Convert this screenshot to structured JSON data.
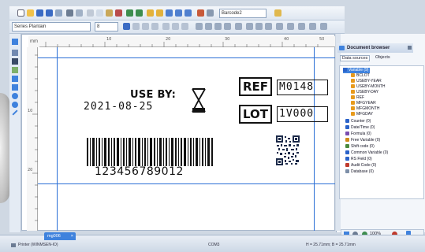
{
  "toolbar": {
    "barcode_combo": "Barcode2",
    "font_combo": "Series Plantain",
    "size_combo": "8"
  },
  "ruler": {
    "units": "mm",
    "marks": [
      "10",
      "20",
      "30",
      "40",
      "50"
    ],
    "left_marks": [
      "10",
      "20"
    ]
  },
  "label": {
    "use_by_text": "USE BY:",
    "date_value": "2021-08-25",
    "ref_label": "REF",
    "ref_value": "M0148",
    "lot_label": "LOT",
    "lot_value": "1V000",
    "barcode_number": "123456789012"
  },
  "panel": {
    "title": "Document browser",
    "tabs": [
      "Data sources",
      "Objects"
    ],
    "tree": [
      {
        "label": "Variable (9)",
        "color": "#2a62c9"
      },
      {
        "label": "BCLOT",
        "color": "#e89a1c"
      },
      {
        "label": "USEBY-YEAR",
        "color": "#e89a1c"
      },
      {
        "label": "USEBY-MONTH",
        "color": "#e89a1c"
      },
      {
        "label": "USEBY-DAY",
        "color": "#e89a1c"
      },
      {
        "label": "REF",
        "color": "#e89a1c"
      },
      {
        "label": "MFGYEAR",
        "color": "#e89a1c"
      },
      {
        "label": "MFGMONTH",
        "color": "#e89a1c"
      },
      {
        "label": "MFGDAY",
        "color": "#e89a1c"
      },
      {
        "label": "Counter (0)",
        "color": "#2a62c9"
      },
      {
        "label": "Date/Time (0)",
        "color": "#2a62c9"
      },
      {
        "label": "Formula (0)",
        "color": "#7a4db0"
      },
      {
        "label": "Free Variable (0)",
        "color": "#d08b1a"
      },
      {
        "label": "Shift code (0)",
        "color": "#4a8a3c"
      },
      {
        "label": "Common Variable (0)",
        "color": "#2a62c9"
      },
      {
        "label": "RS Field (0)",
        "color": "#2a62c9"
      },
      {
        "label": "Audit Code (0)",
        "color": "#c0392b"
      },
      {
        "label": "Database (0)",
        "color": "#7d8fa8"
      }
    ]
  },
  "document_tab": "mg006",
  "zoom": "100%",
  "status": {
    "printer": "Printer (WINMSEN-IO)",
    "port": "COM3",
    "position": "H = 25.71mm; B = 25.71mm"
  }
}
